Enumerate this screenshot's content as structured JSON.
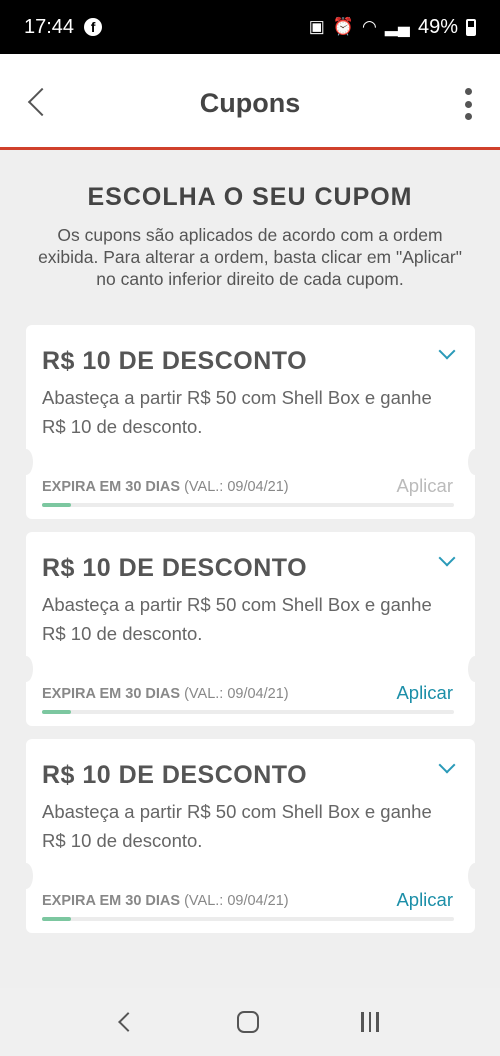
{
  "status_bar": {
    "time": "17:44",
    "facebook_glyph": "f",
    "battery": "49%",
    "icons": [
      "facebook-icon",
      "battery-saver-icon",
      "alarm-icon",
      "wifi-icon",
      "signal-icon",
      "battery-icon"
    ]
  },
  "header": {
    "title": "Cupons"
  },
  "intro": {
    "title": "ESCOLHA O SEU CUPOM",
    "description": "Os cupons são aplicados de acordo com a ordem exibida. Para alterar a ordem, basta clicar em \"Aplicar\" no canto inferior direito de cada cupom."
  },
  "coupons": [
    {
      "title": "R$ 10 DE DESCONTO",
      "description": "Abasteça a partir R$ 50 com Shell Box e ganhe R$ 10 de desconto.",
      "expiry_label": "EXPIRA EM 30 DIAS",
      "validity": "(VAL.: 09/04/21)",
      "apply_label": "Aplicar",
      "apply_enabled": false,
      "progress": 0.07
    },
    {
      "title": "R$ 10 DE DESCONTO",
      "description": "Abasteça a partir R$ 50 com Shell Box e ganhe R$ 10 de desconto.",
      "expiry_label": "EXPIRA EM 30 DIAS",
      "validity": "(VAL.: 09/04/21)",
      "apply_label": "Aplicar",
      "apply_enabled": true,
      "progress": 0.07
    },
    {
      "title": "R$ 10 DE DESCONTO",
      "description": "Abasteça a partir R$ 50 com Shell Box e ganhe R$ 10 de desconto.",
      "expiry_label": "EXPIRA EM 30 DIAS",
      "validity": "(VAL.: 09/04/21)",
      "apply_label": "Aplicar",
      "apply_enabled": true,
      "progress": 0.07
    }
  ],
  "colors": {
    "accent": "#1c8fa8",
    "header_border": "#d0402b",
    "progress": "#7cc7a0"
  }
}
